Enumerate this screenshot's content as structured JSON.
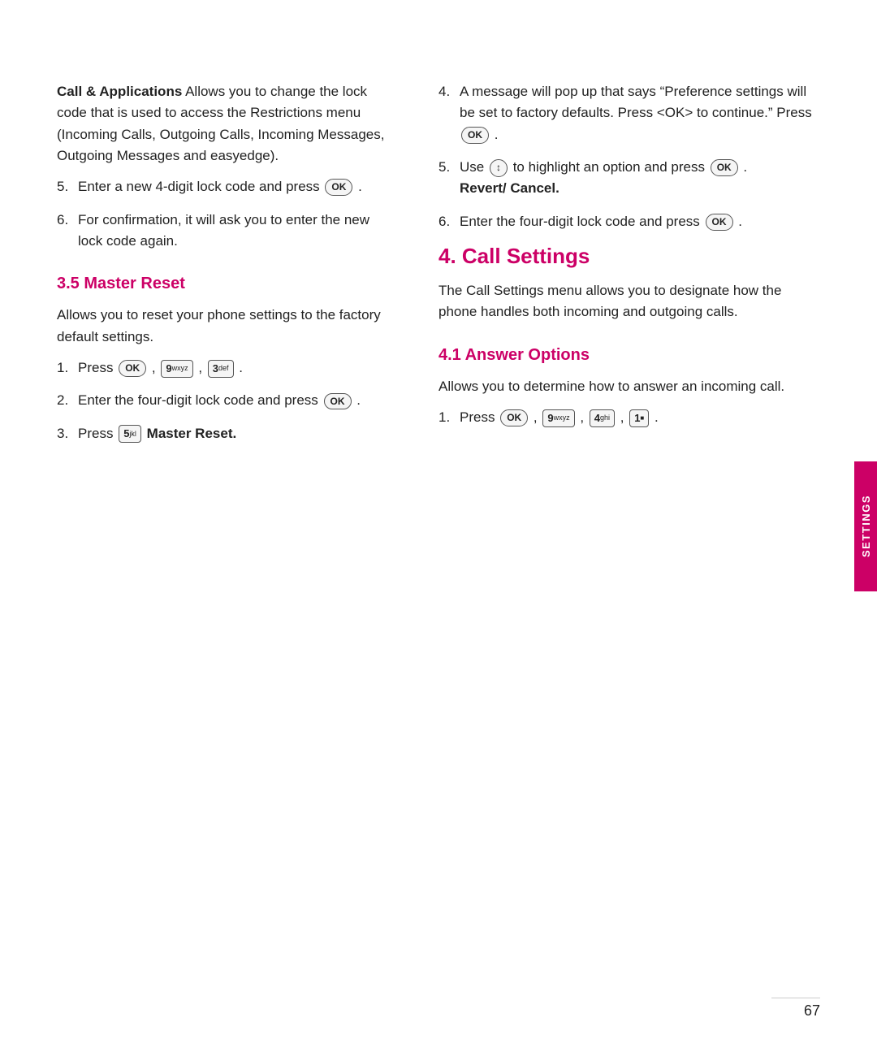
{
  "page": {
    "number": "67",
    "sidebar_label": "Settings",
    "sidebar_color": "#cc0066"
  },
  "left_column": {
    "call_applications_paragraph": "Call & Applications Allows you to change the lock code that is used to access the Restrictions menu (Incoming Calls, Outgoing Calls, Incoming Messages, Outgoing Messages and easyedge).",
    "call_applications_bold": "Call & Applications",
    "step5_label": "5.",
    "step5_text": "Enter a new 4-digit lock code and press",
    "step5_key": "OK",
    "step6_label": "6.",
    "step6_text": "For confirmation, it will ask you to enter the new lock code again.",
    "section_35_heading": "3.5 Master Reset",
    "master_reset_desc": "Allows you to reset your phone settings to the factory default settings.",
    "mr_step1_label": "1.",
    "mr_step1_text": "Press",
    "mr_step1_key1": "OK",
    "mr_step1_key2": "9wxyz",
    "mr_step1_key3": "3 def",
    "mr_step2_label": "2.",
    "mr_step2_text": "Enter the four-digit lock code and press",
    "mr_step2_key": "OK",
    "mr_step3_label": "3.",
    "mr_step3_text": "Press",
    "mr_step3_key": "5 jkl",
    "mr_step3_bold": "Master Reset."
  },
  "right_column": {
    "step4_label": "4.",
    "step4_text": "A message will pop up that says “Preference settings will be set to factory defaults. Press <OK> to continue.” Press",
    "step4_key": "OK",
    "step5_label": "5.",
    "step5_text": "Use",
    "step5_nav_key": "↕",
    "step5_text2": "to highlight an option and press",
    "step5_key": "OK",
    "step5_bold": "Revert/ Cancel.",
    "step6_label": "6.",
    "step6_text": "Enter the four-digit lock code and press",
    "step6_key": "OK",
    "chapter4_heading": "4. Call Settings",
    "chapter4_desc": "The Call Settings menu allows you to designate how the phone handles both incoming and outgoing calls.",
    "section_41_heading": "4.1 Answer Options",
    "section_41_desc": "Allows you to determine how to answer an incoming call.",
    "ao_step1_label": "1.",
    "ao_step1_text": "Press",
    "ao_step1_key1": "OK",
    "ao_step1_key2": "9 wxyz",
    "ao_step1_key3": "4 ghi",
    "ao_step1_key4": "1"
  }
}
